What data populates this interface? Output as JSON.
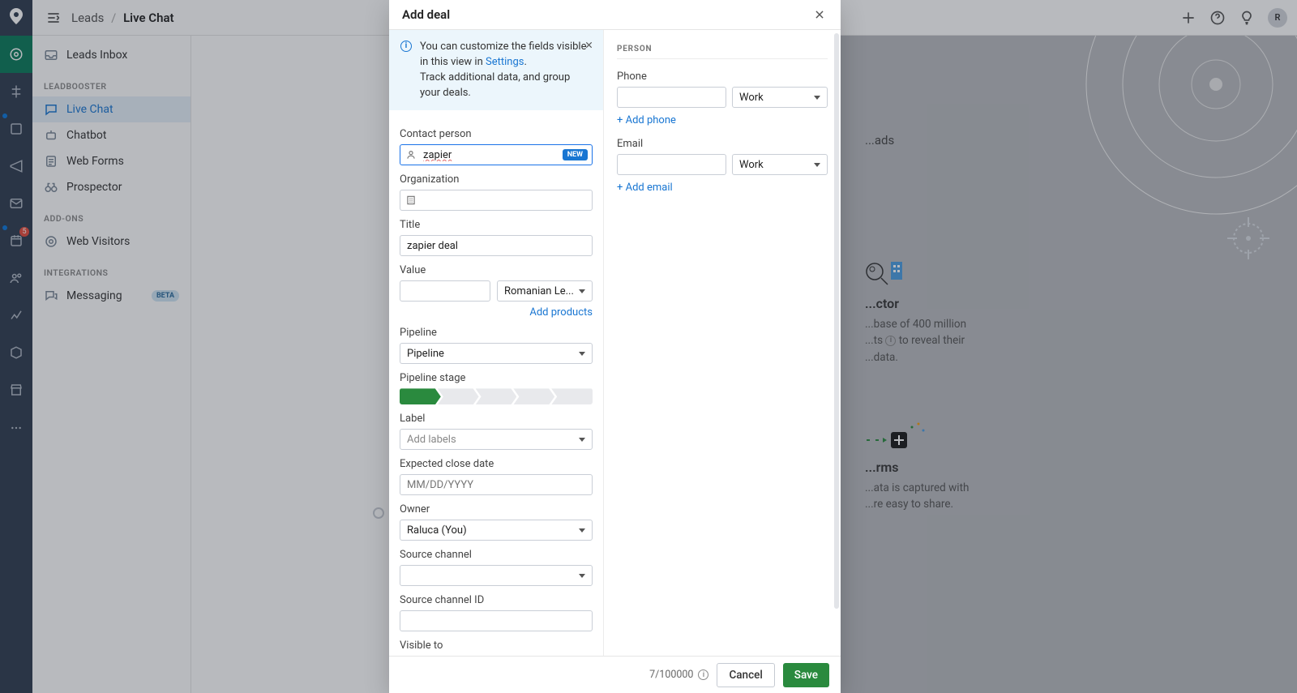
{
  "header": {
    "breadcrumb_root": "Leads",
    "breadcrumb_current": "Live Chat",
    "avatar_initial": "R"
  },
  "vnav": {
    "badge5": "5"
  },
  "sidebar": {
    "inbox": "Leads Inbox",
    "section_leadbooster": "LEADBOOSTER",
    "live_chat": "Live Chat",
    "chatbot": "Chatbot",
    "web_forms": "Web Forms",
    "prospector": "Prospector",
    "section_addons": "ADD-ONS",
    "web_visitors": "Web Visitors",
    "section_integrations": "INTEGRATIONS",
    "messaging": "Messaging",
    "beta_label": "BETA"
  },
  "background": {
    "hdr_leads": "...ads",
    "prospector_title": "...ctor",
    "prosp_line1": "...base of 400 million",
    "prosp_line2a": "...ts ",
    "prosp_line2b": " to reveal their",
    "prosp_line3": "...data.",
    "forms_title": "...rms",
    "forms_line1": "...ata is captured with",
    "forms_line2": "...re easy to share."
  },
  "modal": {
    "title": "Add deal",
    "info_line1": "You can customize the fields visible in this view in ",
    "info_settings": "Settings",
    "info_dot": ".",
    "info_line2": "Track additional data, and group your deals.",
    "labels": {
      "contact_person": "Contact person",
      "organization": "Organization",
      "title": "Title",
      "value": "Value",
      "pipeline": "Pipeline",
      "pipeline_stage": "Pipeline stage",
      "label": "Label",
      "expected_close": "Expected close date",
      "owner": "Owner",
      "source_channel": "Source channel",
      "source_channel_id": "Source channel ID",
      "visible_to": "Visible to"
    },
    "values": {
      "contact_person": "zapier",
      "contact_new": "NEW",
      "organization": "",
      "title": "zapier deal",
      "value": "",
      "currency": "Romanian Le...",
      "add_products": "Add products",
      "pipeline": "Pipeline",
      "label": "Add labels",
      "expected_close_placeholder": "MM/DD/YYYY",
      "owner": "Raluca (You)",
      "source_channel": "",
      "source_channel_id": ""
    },
    "person": {
      "section": "PERSON",
      "phone_label": "Phone",
      "phone_type": "Work",
      "add_phone": "+ Add phone",
      "email_label": "Email",
      "email_type": "Work",
      "add_email": "+ Add email"
    },
    "footer": {
      "count": "7/100000",
      "cancel": "Cancel",
      "save": "Save"
    }
  }
}
